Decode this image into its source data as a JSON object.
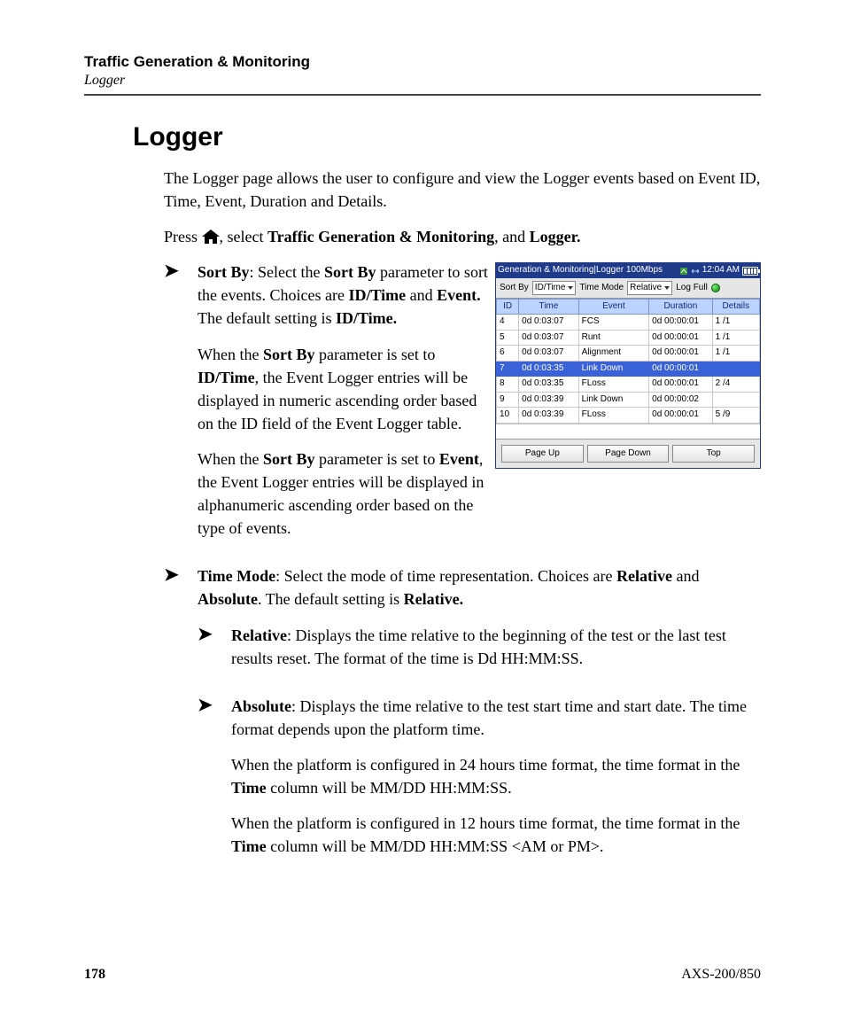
{
  "header": {
    "chapter": "Traffic Generation & Monitoring",
    "section": "Logger"
  },
  "title": "Logger",
  "intro": "The Logger page allows the user to configure and view the Logger events based on Event ID, Time, Event, Duration and Details.",
  "press_line": {
    "prefix": "Press ",
    "mid": ", select ",
    "nav1": "Traffic Generation & Monitoring",
    "mid2": ", and ",
    "nav2": "Logger."
  },
  "bullet1": {
    "lead_bold": "Sort By",
    "lead_rest": ": Select the ",
    "lead_bold2": "Sort By",
    "lead_rest2": " parameter to sort the events. Choices are ",
    "c1": "ID/Time",
    "and": " and ",
    "c2": "Event.",
    "tail": " The default setting is ",
    "def": "ID/Time.",
    "p2a": "When the ",
    "p2b": "Sort By",
    "p2c": " parameter is set to ",
    "p2d": "ID/Time",
    "p2e": ", the Event Logger entries will be displayed in numeric ascending order based on the ID field of the Event Logger table.",
    "p3a": "When the ",
    "p3b": "Sort By",
    "p3c": " parameter is set to ",
    "p3d": "Event",
    "p3e": ", the Event Logger entries will be displayed in alphanumeric ascending order based on the type of events."
  },
  "bullet2": {
    "lead_bold": "Time Mode",
    "rest1": ": Select the mode of time representation. Choices are ",
    "c1": "Relative",
    "and": " and ",
    "c2": "Absolute",
    "rest2": ". The default setting is ",
    "def": "Relative."
  },
  "sub1": {
    "lead": "Relative",
    "rest": ": Displays the time relative to the beginning of the test or the last test results reset. The format of the time is Dd HH:MM:SS."
  },
  "sub2": {
    "lead": "Absolute",
    "rest": ": Displays the time relative to the test start time and start date. The time format depends upon the platform time.",
    "p2a": "When the platform is configured in 24 hours time format, the time format in the ",
    "p2b": "Time",
    "p2c": " column will be MM/DD HH:MM:SS.",
    "p3a": "When the platform is configured in 12 hours time format, the time format in the ",
    "p3b": "Time",
    "p3c": " column will be MM/DD HH:MM:SS <AM or PM>."
  },
  "device": {
    "titlebar": {
      "text": "Generation  & Monitoring|Logger 100Mbps",
      "clock": "12:04 AM"
    },
    "controls": {
      "sortby_label": "Sort By",
      "sortby_value": "ID/Time",
      "timemode_label": "Time Mode",
      "timemode_value": "Relative",
      "logfull_label": "Log Full"
    },
    "columns": {
      "id": "ID",
      "time": "Time",
      "event": "Event",
      "duration": "Duration",
      "details": "Details"
    },
    "rows": [
      {
        "id": "4",
        "time": "0d 0:03:07",
        "event": "FCS",
        "duration": "0d 00:00:01",
        "details": "1 /1",
        "selected": false
      },
      {
        "id": "5",
        "time": "0d 0:03:07",
        "event": "Runt",
        "duration": "0d 00:00:01",
        "details": "1 /1",
        "selected": false
      },
      {
        "id": "6",
        "time": "0d 0:03:07",
        "event": "Alignment",
        "duration": "0d 00:00:01",
        "details": "1 /1",
        "selected": false
      },
      {
        "id": "7",
        "time": "0d 0:03:35",
        "event": "Link Down",
        "duration": "0d 00:00:01",
        "details": "",
        "selected": true
      },
      {
        "id": "8",
        "time": "0d 0:03:35",
        "event": "FLoss",
        "duration": "0d 00:00:01",
        "details": "2 /4",
        "selected": false
      },
      {
        "id": "9",
        "time": "0d 0:03:39",
        "event": "Link Down",
        "duration": "0d 00:00:02",
        "details": "",
        "selected": false
      },
      {
        "id": "10",
        "time": "0d 0:03:39",
        "event": "FLoss",
        "duration": "0d 00:00:01",
        "details": "5 /9",
        "selected": false
      }
    ],
    "buttons": {
      "pageup": "Page Up",
      "pagedown": "Page Down",
      "top": "Top"
    }
  },
  "footer": {
    "page": "178",
    "doc": "AXS-200/850"
  }
}
